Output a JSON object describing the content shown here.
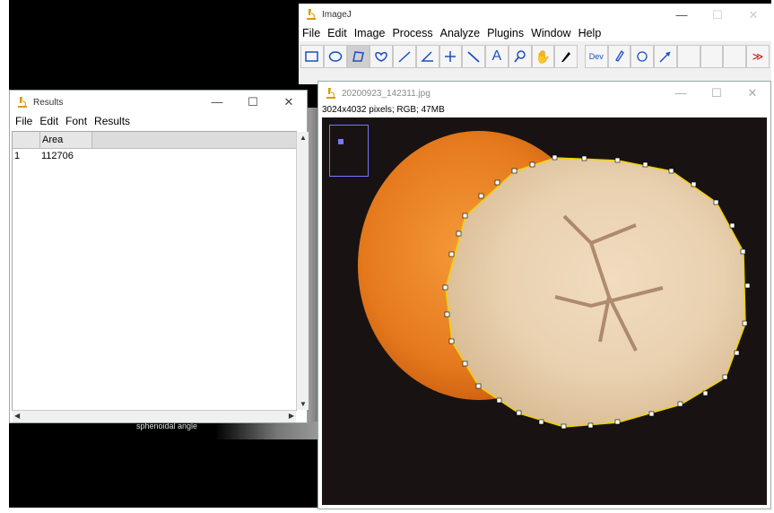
{
  "background": {
    "label": "sphenoidal angle"
  },
  "imagej": {
    "title": "ImageJ",
    "menu": [
      "File",
      "Edit",
      "Image",
      "Process",
      "Analyze",
      "Plugins",
      "Window",
      "Help"
    ],
    "tools": [
      "rectangle-tool-icon",
      "oval-tool-icon",
      "polygon-tool-icon",
      "freehand-tool-icon",
      "line-tool-icon",
      "angle-tool-icon",
      "point-tool-icon",
      "wand-tool-icon",
      "text-tool-icon",
      "magnifier-tool-icon",
      "hand-tool-icon",
      "color-picker-icon",
      "dev-icon",
      "brush-icon",
      "flood-fill-icon",
      "arrow-tool-icon"
    ],
    "dev_label": "Dev",
    "more_label": "≫"
  },
  "results": {
    "title": "Results",
    "menu": [
      "File",
      "Edit",
      "Font",
      "Results"
    ],
    "columns": [
      "Area"
    ],
    "rows": [
      {
        "index": "1",
        "area": "112706"
      }
    ]
  },
  "image_window": {
    "title": "20200923_142311.jpg",
    "info": "3024x4032 pixels; RGB; 47MB"
  },
  "colors": {
    "selection": "#f2d200",
    "accent": "#1a50c0",
    "orange": "#e8731a"
  }
}
